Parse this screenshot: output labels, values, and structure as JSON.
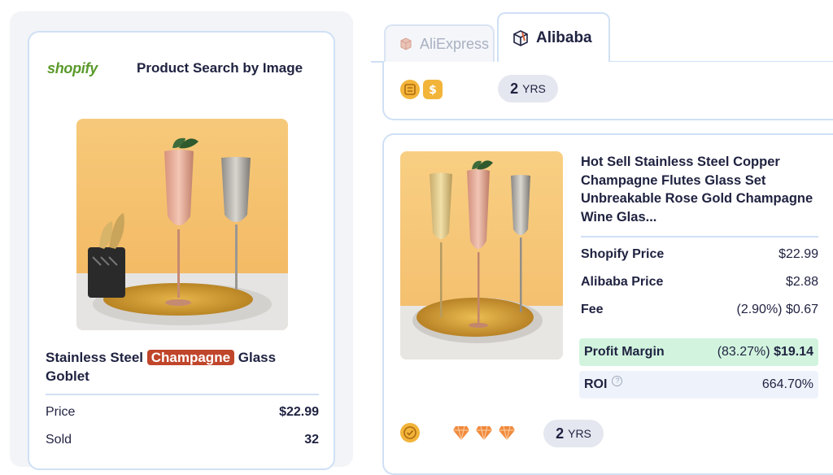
{
  "left": {
    "shopify_logo": "shopify",
    "search_title": "Product Search by Image",
    "product_title_pre": "Stainless Steel ",
    "product_title_highlight": "Champagne",
    "product_title_post": " Glass Goblet",
    "rows": [
      {
        "label": "Price",
        "value": "$22.99"
      },
      {
        "label": "Sold",
        "value": "32"
      }
    ]
  },
  "tabs": {
    "aliexpress": "AliExpress",
    "alibaba": "Alibaba",
    "active": "alibaba"
  },
  "seller": {
    "years_number": "2",
    "years_unit": "YRS"
  },
  "result": {
    "title": "Hot Sell Stainless Steel Copper Champagne Flutes Glass Set Unbreakable Rose Gold Champagne Wine Glas...",
    "shopify_price_label": "Shopify Price",
    "shopify_price": "$22.99",
    "alibaba_price_label": "Alibaba Price",
    "alibaba_price": "$2.88",
    "fee_label": "Fee",
    "fee_value": "(2.90%) $0.67",
    "profit_label": "Profit Margin",
    "profit_pct": "(83.27%)",
    "profit_value": "$19.14",
    "roi_label": "ROI",
    "roi_value": "664.70%",
    "years_number": "2",
    "years_unit": "YRS"
  },
  "colors": {
    "accent_border": "#cfe0f5",
    "highlight": "#c0462b",
    "profit_bg": "#d2f4de",
    "shopify_green": "#5a9a2c"
  }
}
